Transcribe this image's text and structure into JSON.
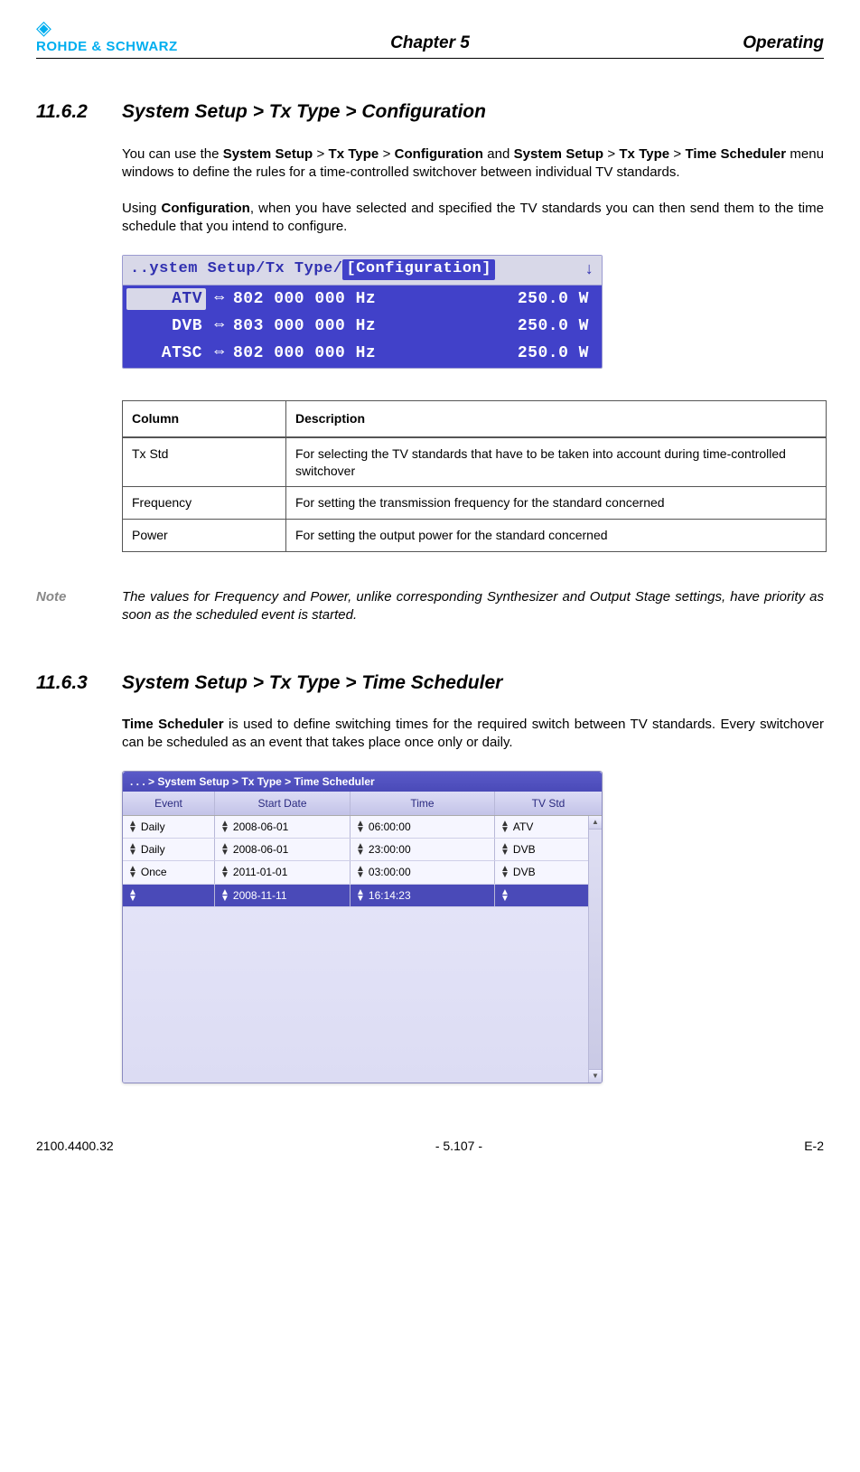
{
  "header": {
    "logo_text": "ROHDE & SCHWARZ",
    "chapter": "Chapter 5",
    "right": "Operating"
  },
  "section1": {
    "number": "11.6.2",
    "title": "System Setup > Tx Type > Configuration",
    "para1_pre": "You can use the ",
    "para1_b1": "System Setup",
    "para1_m1": " > ",
    "para1_b2": "Tx Type",
    "para1_m2": " > ",
    "para1_b3": "Configuration",
    "para1_m3": " and ",
    "para1_b4": "System Setup",
    "para1_m4": " > ",
    "para1_b5": "Tx Type",
    "para1_m5": " > ",
    "para1_b6": "Time Scheduler",
    "para1_post": " menu windows to define the rules for a time-controlled switchover between individual TV standards.",
    "para2_pre": "Using ",
    "para2_b1": "Configuration",
    "para2_post": ", when you have selected and specified the TV standards you can then send them to the time schedule that you intend to configure."
  },
  "screenshot1": {
    "crumb_plain": "..ystem Setup/Tx Type/",
    "crumb_selected": "[Configuration]",
    "rows": [
      {
        "std": "ATV",
        "freq": "802 000 000 Hz",
        "power": "250.0 W",
        "selected": true
      },
      {
        "std": "DVB",
        "freq": "803 000 000 Hz",
        "power": "250.0 W",
        "selected": false
      },
      {
        "std": "ATSC",
        "freq": "802 000 000 Hz",
        "power": "250.0 W",
        "selected": false
      }
    ]
  },
  "desc_table": {
    "col_head": "Column",
    "desc_head": "Description",
    "rows": [
      {
        "col": "Tx Std",
        "desc": "For selecting the TV standards that have to be taken into account during time-controlled switchover"
      },
      {
        "col": "Frequency",
        "desc": "For setting the transmission frequency for the standard concerned"
      },
      {
        "col": "Power",
        "desc": "For setting the output power for the standard concerned"
      }
    ]
  },
  "note": {
    "label": "Note",
    "text": "The values for Frequency and Power, unlike corresponding Synthesizer and Output Stage settings, have priority as soon as the scheduled event is started."
  },
  "section2": {
    "number": "11.6.3",
    "title": "System Setup > Tx Type > Time Scheduler",
    "para_b1": "Time Scheduler",
    "para_post": " is used to define switching times for the required switch between TV standards. Every switchover can be scheduled as an event that takes place once only or daily."
  },
  "screenshot2": {
    "title": ". . . > System Setup > Tx Type > Time Scheduler",
    "headers": {
      "event": "Event",
      "date": "Start Date",
      "time": "Time",
      "std": "TV Std"
    },
    "rows": [
      {
        "event": "Daily",
        "date": "2008-06-01",
        "time": "06:00:00",
        "std": "ATV",
        "selected": false
      },
      {
        "event": "Daily",
        "date": "2008-06-01",
        "time": "23:00:00",
        "std": "DVB",
        "selected": false
      },
      {
        "event": "Once",
        "date": "2011-01-01",
        "time": "03:00:00",
        "std": "DVB",
        "selected": false
      },
      {
        "event": "",
        "date": "2008-11-11",
        "time": "16:14:23",
        "std": "",
        "selected": true
      }
    ]
  },
  "footer": {
    "left": "2100.4400.32",
    "center": "- 5.107 -",
    "right": "E-2"
  }
}
